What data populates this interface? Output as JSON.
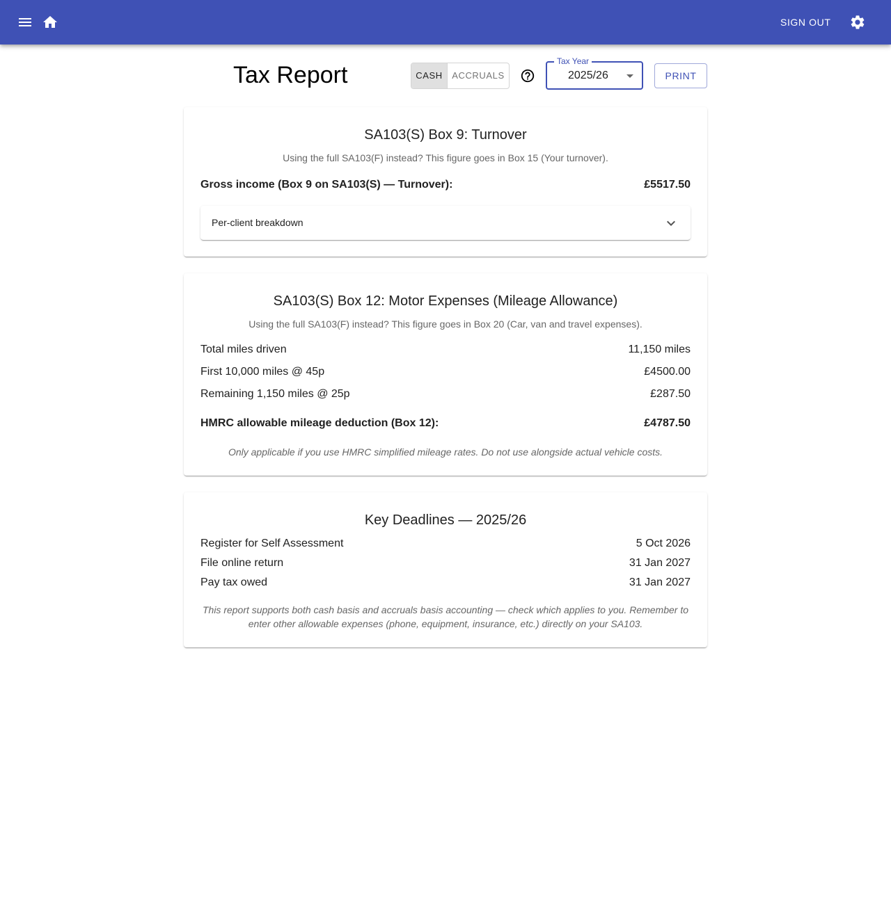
{
  "appbar": {
    "menu_icon": "menu-icon",
    "home_icon": "home-icon",
    "sign_out_label": "SIGN OUT",
    "settings_icon": "gear-icon",
    "color": "#3f51b5"
  },
  "header": {
    "title": "Tax Report",
    "basis_options": [
      "CASH",
      "ACCRUALS"
    ],
    "selected_basis": "CASH",
    "help_icon": "help-circle-icon",
    "tax_year_label": "Tax Year",
    "tax_year_value": "2025/26",
    "print_label": "PRINT"
  },
  "turnover": {
    "title": "SA103(S) Box 9: Turnover",
    "subtitle": "Using the full SA103(F) instead? This figure goes in Box 15 (Your turnover).",
    "gross_label": "Gross income (Box 9 on SA103(S) — Turnover):",
    "gross_value": "£5517.50",
    "breakdown_label": "Per-client breakdown",
    "breakdown_expanded": false
  },
  "mileage": {
    "title": "SA103(S) Box 12: Motor Expenses (Mileage Allowance)",
    "subtitle": "Using the full SA103(F) instead? This figure goes in Box 20 (Car, van and travel expenses).",
    "rows": [
      {
        "label": "Total miles driven",
        "value": "11,150 miles"
      },
      {
        "label": "First 10,000 miles @ 45p",
        "value": "£4500.00"
      },
      {
        "label": "Remaining 1,150 miles @ 25p",
        "value": "£287.50"
      }
    ],
    "total_label": "HMRC allowable mileage deduction (Box 12):",
    "total_value": "£4787.50",
    "note": "Only applicable if you use HMRC simplified mileage rates. Do not use alongside actual vehicle costs."
  },
  "deadlines": {
    "title": "Key Deadlines — 2025/26",
    "rows": [
      {
        "label": "Register for Self Assessment",
        "value": "5 Oct 2026"
      },
      {
        "label": "File online return",
        "value": "31 Jan 2027"
      },
      {
        "label": "Pay tax owed",
        "value": "31 Jan 2027"
      }
    ],
    "note": "This report supports both cash basis and accruals basis accounting — check which applies to you. Remember to enter other allowable expenses (phone, equipment, insurance, etc.) directly on your SA103."
  }
}
